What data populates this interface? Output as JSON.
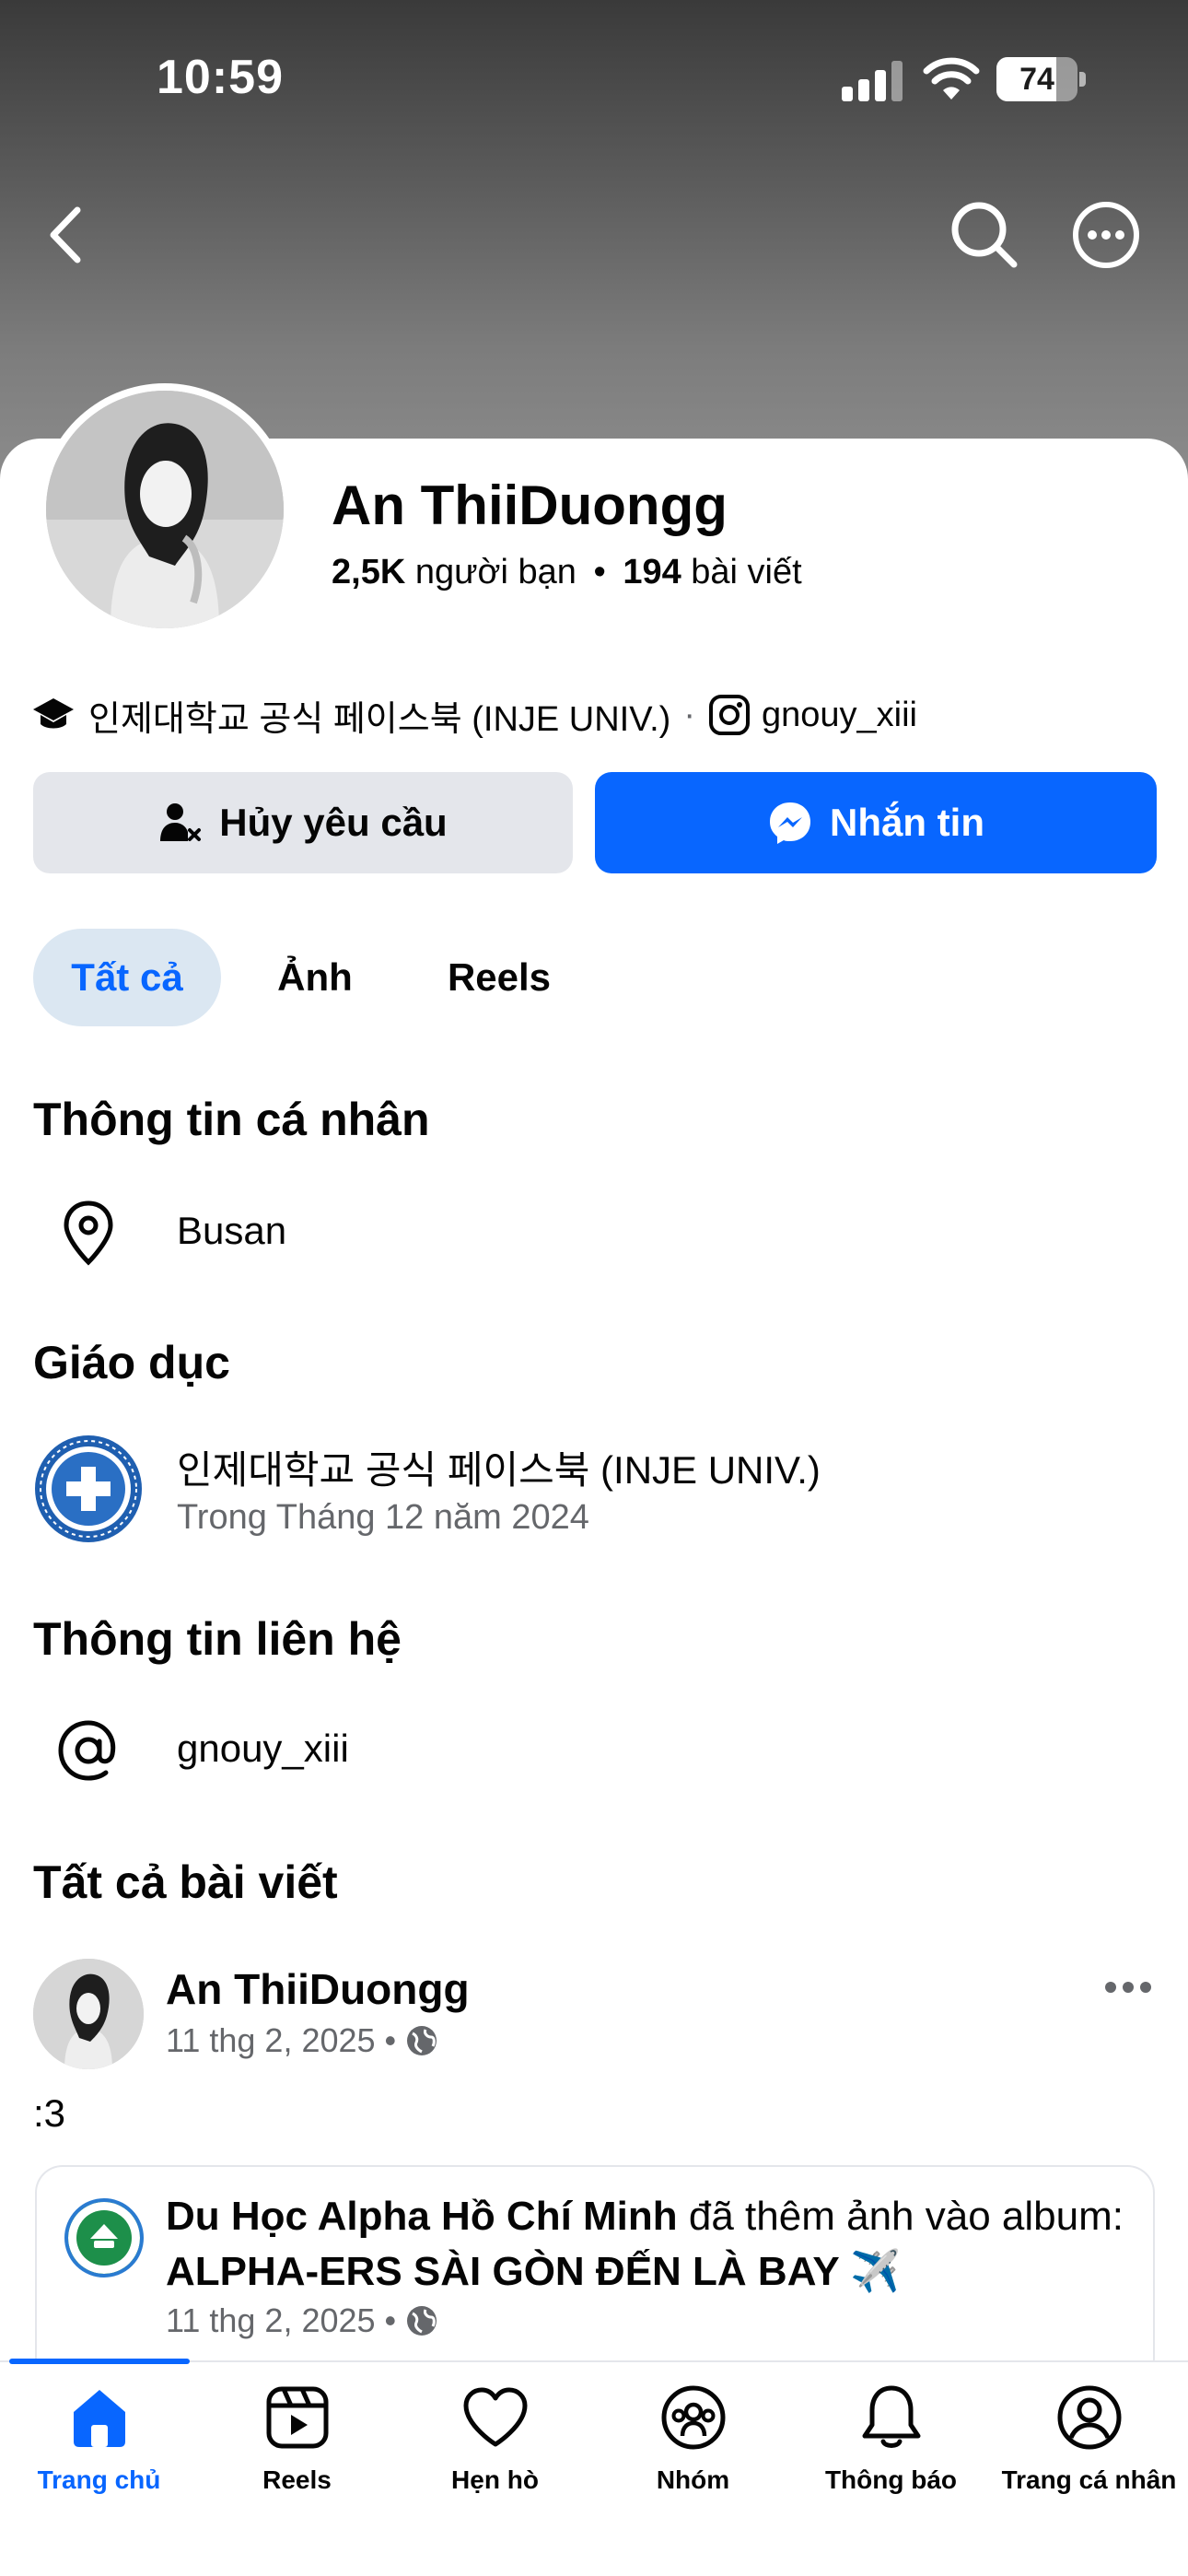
{
  "status_bar": {
    "time": "10:59",
    "battery_level": 74,
    "battery_text": "74"
  },
  "profile": {
    "name": "An ThiiDuongg",
    "friends_count": "2,5K",
    "friends_label": "người bạn",
    "separator": "•",
    "posts_count": "194",
    "posts_label": "bài viết",
    "school": "인제대학교 공식 페이스북 (INJE UNIV.)",
    "bio_separator": "·",
    "instagram": "gnouy_xiii"
  },
  "actions": {
    "cancel_request": "Hủy yêu cầu",
    "message": "Nhắn tin"
  },
  "tabs": [
    {
      "label": "Tất cả",
      "active": true
    },
    {
      "label": "Ảnh",
      "active": false
    },
    {
      "label": "Reels",
      "active": false
    }
  ],
  "personal_info": {
    "title": "Thông tin cá nhân",
    "location": "Busan"
  },
  "education": {
    "title": "Giáo dục",
    "school": "인제대학교 공식 페이스북 (INJE UNIV.)",
    "period": "Trong Tháng 12 năm 2024"
  },
  "contact_info": {
    "title": "Thông tin liên hệ",
    "instagram": "gnouy_xiii"
  },
  "posts_section": {
    "title": "Tất cả bài viết"
  },
  "post": {
    "author": "An ThiiDuongg",
    "date": "11 thg 2, 2025",
    "dot": "•",
    "text": ":3",
    "shared": {
      "page_name": "Du Học Alpha Hồ Chí Minh",
      "action": "đã thêm ảnh vào album:",
      "album": "ALPHA-ERS SÀI GÒN ĐẾN LÀ BAY ✈️",
      "date": "11 thg 2, 2025",
      "dot": "•"
    }
  },
  "bottom_nav": [
    {
      "label": "Trang chủ",
      "icon": "home-icon",
      "active": true
    },
    {
      "label": "Reels",
      "icon": "reels-icon",
      "active": false
    },
    {
      "label": "Hẹn hò",
      "icon": "heart-icon",
      "active": false
    },
    {
      "label": "Nhóm",
      "icon": "groups-icon",
      "active": false
    },
    {
      "label": "Thông báo",
      "icon": "bell-icon",
      "active": false
    },
    {
      "label": "Trang cá nhân",
      "icon": "profile-icon",
      "active": false
    }
  ],
  "colors": {
    "accent": "#0866ff",
    "tab_active_bg": "#dbe7f2",
    "button_gray": "#e4e6eb",
    "muted_text": "#65676b"
  }
}
